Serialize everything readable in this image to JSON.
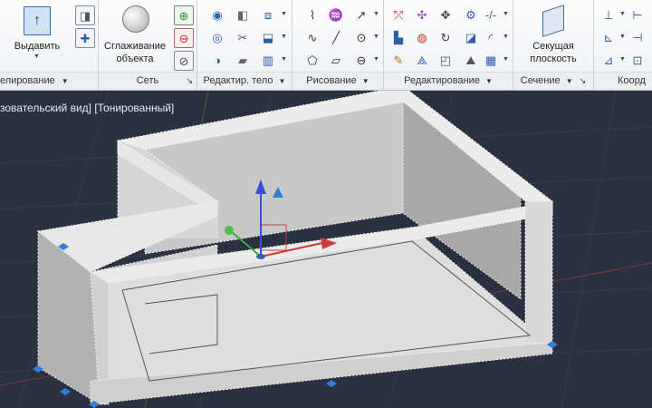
{
  "ribbon": {
    "panels": [
      {
        "title": "елирование",
        "big_label": "Выдавить"
      },
      {
        "title": "Сеть",
        "big_label_1": "Сглаживание",
        "big_label_2": "объекта"
      },
      {
        "title": "Редактир. тело"
      },
      {
        "title": "Рисование"
      },
      {
        "title": "Редактирование"
      },
      {
        "title": "Сечение",
        "big_label_1": "Секущая",
        "big_label_2": "плоскость"
      },
      {
        "title": "Коорд"
      }
    ],
    "dropdown_glyph": "▼",
    "launcher_glyph": "↘"
  },
  "viewport": {
    "label": "зовательский вид] [Тонированный]"
  },
  "colors": {
    "canvas": "#2a3140",
    "solid_light": "#dcdcdc",
    "solid_mid": "#b9b9b9",
    "solid_dark": "#8e8e8e",
    "gizmo_x": "#d13a3a",
    "gizmo_y": "#3fa63f",
    "gizmo_z": "#3a4fd1",
    "grip": "#2f7fd6"
  }
}
